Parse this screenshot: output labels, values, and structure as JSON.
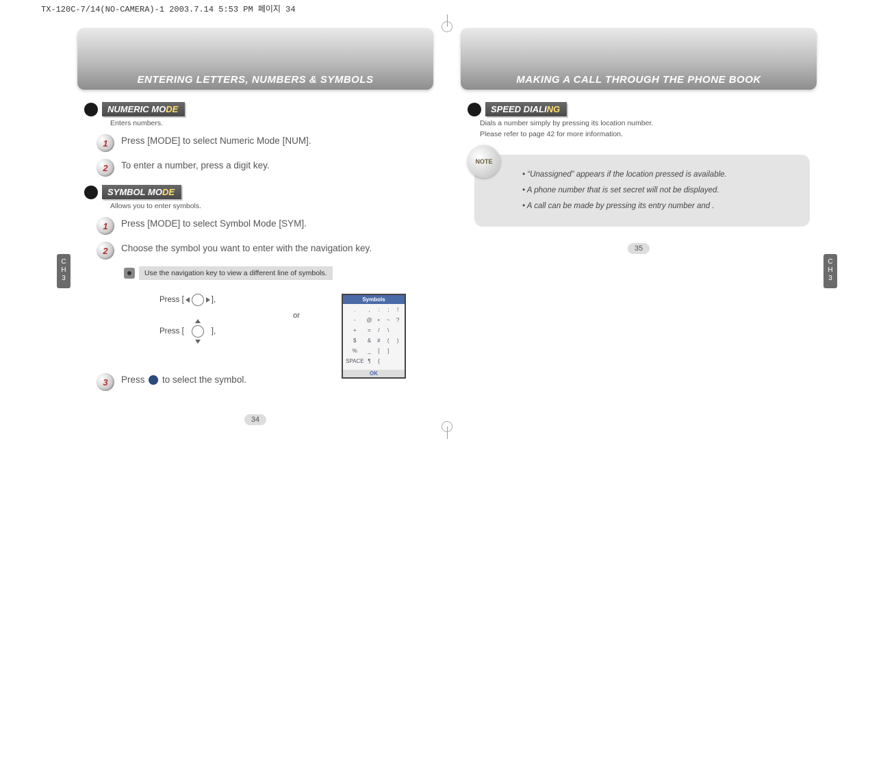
{
  "file_info": "TX-120C-7/14(NO-CAMERA)-1  2003.7.14 5:53 PM  페이지 34",
  "chapter_tab": {
    "line1": "C",
    "line2": "H",
    "num": "3"
  },
  "left": {
    "banner": "ENTERING LETTERS, NUMBERS & SYMBOLS",
    "sec_numeric": {
      "prefix": "NUMERIC MO",
      "hi": "DE"
    },
    "numeric_sub": "Enters numbers.",
    "num_step1": "Press        [MODE] to select Numeric Mode [NUM].",
    "num_step2": "To enter a number, press a digit key.",
    "sec_symbol": {
      "prefix": "SYMBOL MO",
      "hi": "DE"
    },
    "symbol_sub": "Allows you to enter symbols.",
    "sym_step1": "Press        [MODE] to select Symbol Mode [SYM].",
    "sym_step2": "Choose the symbol you want to enter with the navigation key.",
    "sym_mini": "Use the navigation key to view a different line of symbols.",
    "press_label_a": "Press [",
    "press_label_b": "],",
    "or": "or",
    "phone_title": "Symbols",
    "phone_ok": "OK",
    "phone_cells": [
      ".",
      ",",
      ":",
      ";",
      "!",
      "-",
      "@",
      "•",
      "~",
      "?",
      "+",
      "=",
      "/",
      "\\",
      "",
      "$",
      "&",
      "#",
      "(",
      ")",
      "%",
      "_",
      "[",
      "]",
      "",
      "SPACE",
      "¶",
      "{",
      ""
    ],
    "sym_step3": "Press       to select the symbol.",
    "pagenum": "34"
  },
  "right": {
    "banner": "MAKING A CALL THROUGH THE PHONE BOOK",
    "sec_speed": {
      "prefix": "SPEED DIALI",
      "hi": "NG"
    },
    "speed_sub1": "Dials a number simply by pressing its location number.",
    "speed_sub2": "Please refer to page 42 for more information.",
    "note_badge": "NOTE",
    "note_items": [
      "“Unassigned” appears if the location pressed is available.",
      "A phone number that is set secret will not be displayed.",
      "A call can be made by pressing its entry number and        ."
    ],
    "pagenum": "35"
  }
}
